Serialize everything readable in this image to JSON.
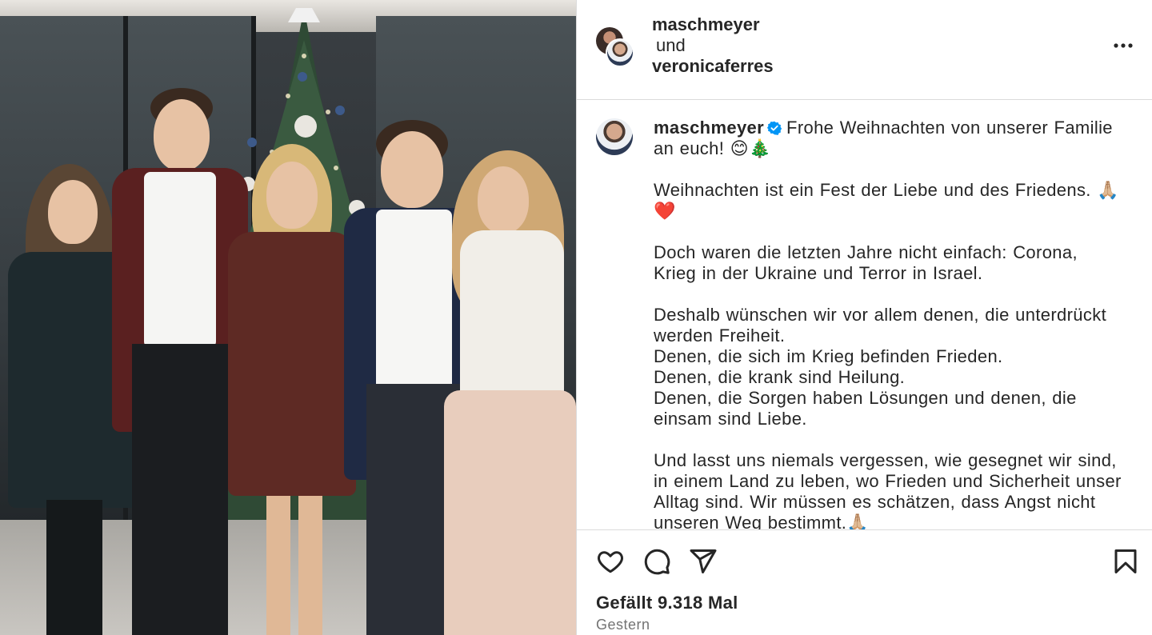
{
  "post": {
    "photo_alt_icon": "family-christmas-photo",
    "header": {
      "user1": "maschmeyer",
      "conjunction": "und",
      "user2": "veronicaferres"
    },
    "caption": {
      "username": "maschmeyer",
      "verified": true,
      "line1": "Frohe Weihnachten von unserer Familie an euch! 😊🎄",
      "para2": "Weihnachten ist ein Fest der Liebe und des Friedens. 🙏🏼❤️",
      "para3": "Doch waren die letzten Jahre nicht einfach: Corona, Krieg in der Ukraine und Terror in Israel.",
      "para4": "Deshalb wünschen wir vor allem denen, die unterdrückt werden Freiheit.\nDenen, die sich im Krieg befinden Frieden.\nDenen, die krank sind Heilung.\nDenen, die Sorgen haben Lösungen und denen, die einsam sind Liebe.",
      "para5": "Und lasst uns niemals vergessen, wie gesegnet wir sind, in einem Land zu leben, wo Frieden und Sicherheit unser Alltag sind. Wir müssen es schätzen, dass Angst nicht unseren Weg bestimmt.🙏🏼"
    },
    "actions": [
      "heart-icon",
      "comment-icon",
      "share-icon",
      "bookmark-icon"
    ],
    "likes_text": "Gefällt 9.318 Mal",
    "date_text": "Gestern"
  },
  "colors": {
    "text": "#262626",
    "secondary": "#737373",
    "border": "#dbdbdb",
    "verified": "#0095f6"
  }
}
